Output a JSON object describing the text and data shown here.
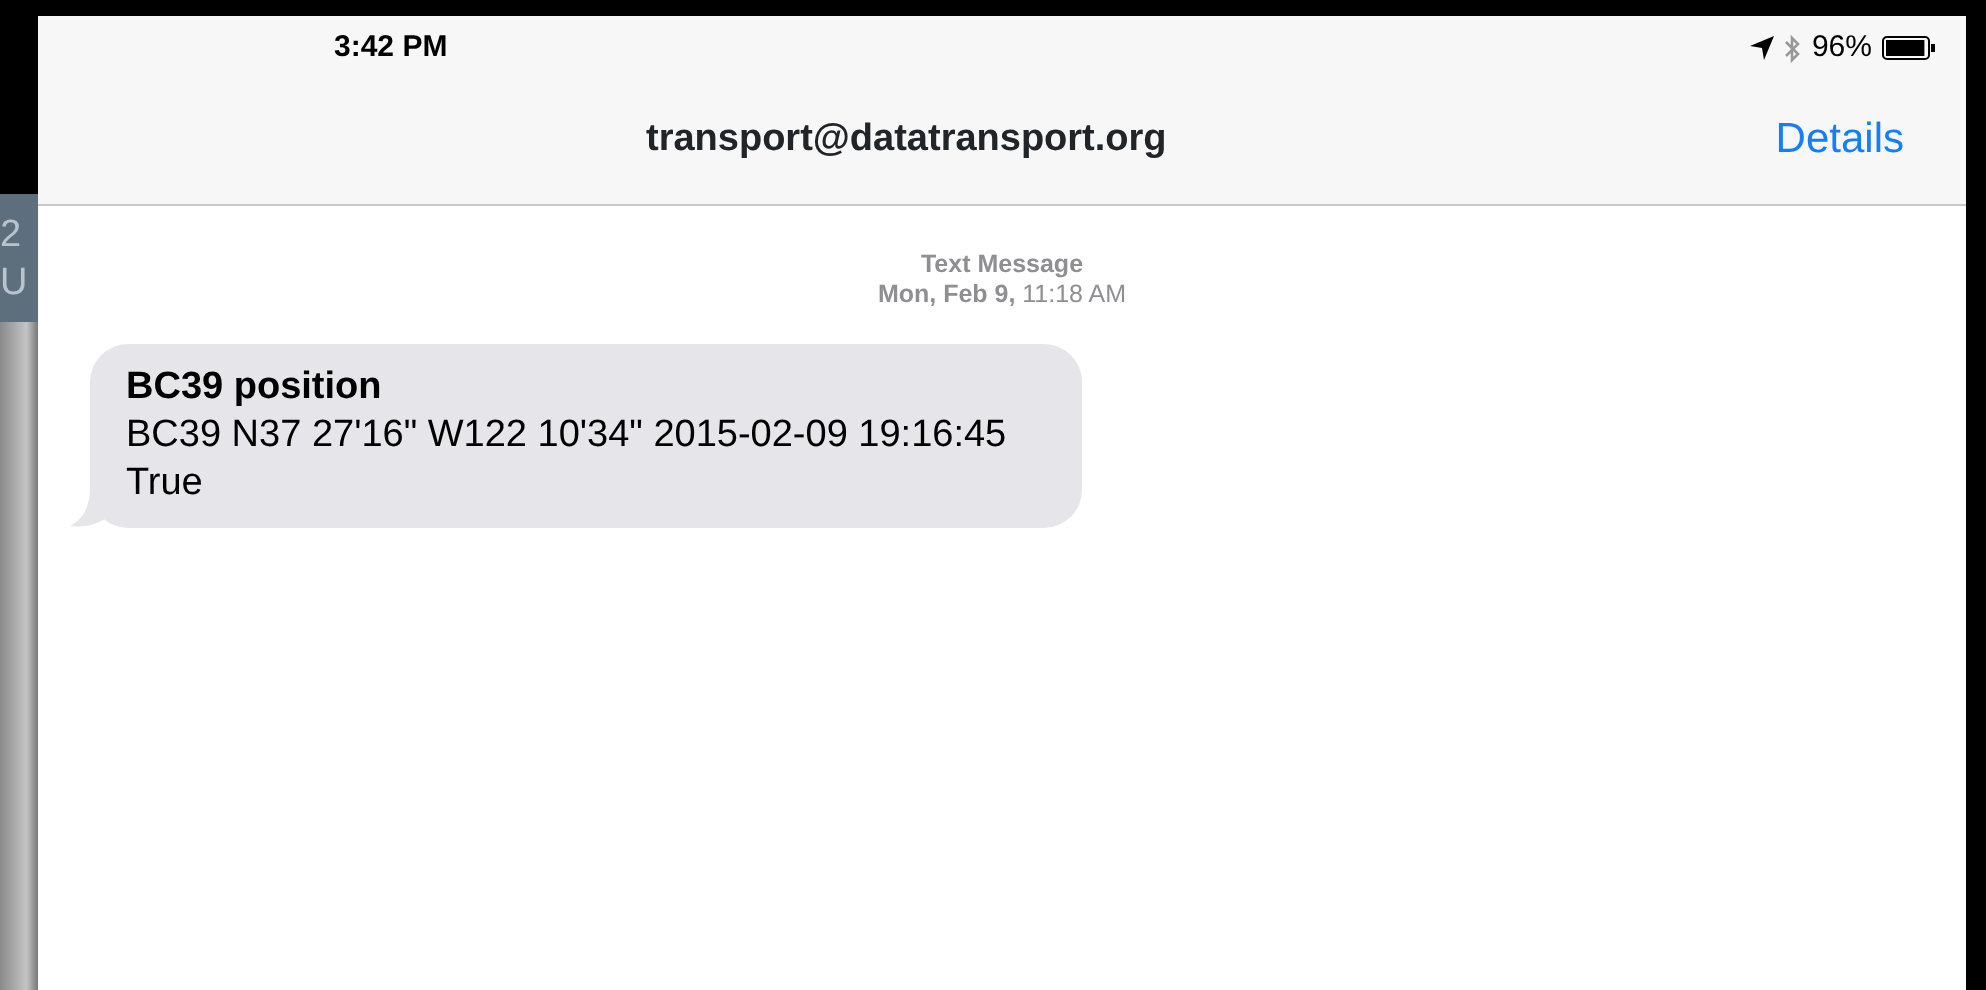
{
  "background_window": {
    "texts": [
      "2",
      "U"
    ]
  },
  "status_bar": {
    "time": "3:42 PM",
    "battery_percent": "96%",
    "battery": {
      "level": 0.96
    }
  },
  "nav_bar": {
    "title": "transport@datatransport.org",
    "action": "Details"
  },
  "conversation": {
    "header": "Text Message",
    "timestamp": "**Mon, Feb 9,** 11:18 AM",
    "messages": [
      {
        "title": "BC39 position",
        "body": "BC39 N37 27'16\" W122 10'34\" 2015-02-09 19:16:45 True"
      }
    ]
  }
}
